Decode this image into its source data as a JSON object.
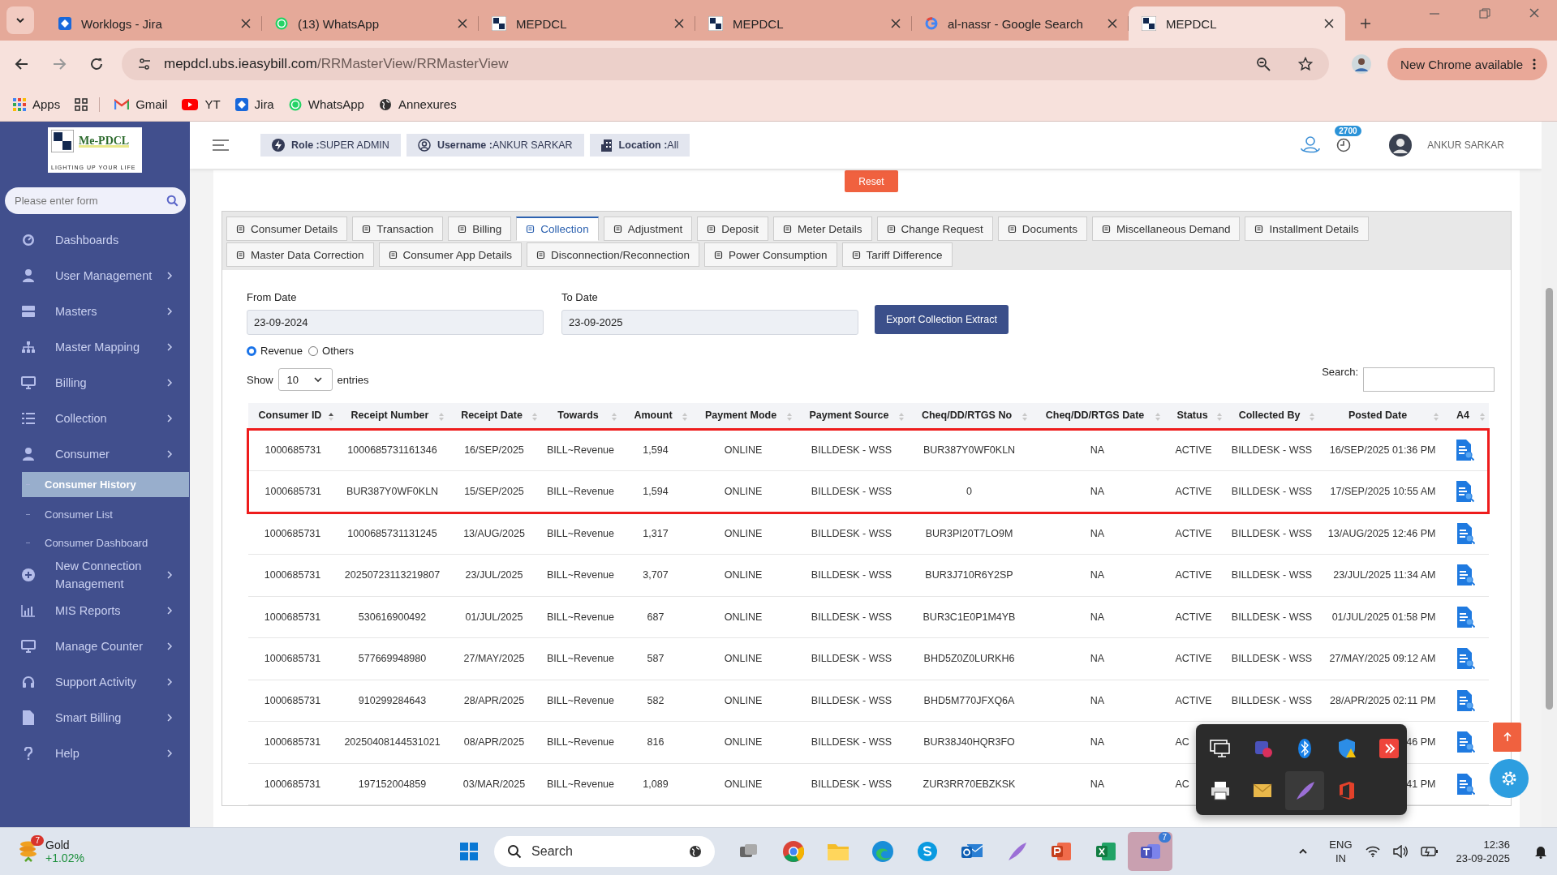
{
  "browser": {
    "tabs": [
      {
        "title": "Worklogs - Jira",
        "selected": false
      },
      {
        "title": "(13) WhatsApp",
        "selected": false
      },
      {
        "title": "MEPDCL",
        "selected": false
      },
      {
        "title": "MEPDCL",
        "selected": false
      },
      {
        "title": "al-nassr - Google Search",
        "selected": false
      },
      {
        "title": "MEPDCL",
        "selected": true
      }
    ],
    "url_host": "mepdcl.ubs.ieasybill.com",
    "url_path": "/RRMasterView/RRMasterView",
    "update_button": "New Chrome available",
    "bookmarks": [
      {
        "label": "Apps"
      },
      {
        "label": "Gmail"
      },
      {
        "label": "YT"
      },
      {
        "label": "Jira"
      },
      {
        "label": "WhatsApp"
      },
      {
        "label": "Annexures"
      }
    ]
  },
  "sidebar": {
    "logo": {
      "name": "Me-PDCL",
      "tagline": "LIGHTING UP YOUR LIFE"
    },
    "search": {
      "placeholder": "Please enter form"
    },
    "items": [
      {
        "label": "Dashboards",
        "arrow": false
      },
      {
        "label": "User Management",
        "arrow": true
      },
      {
        "label": "Masters",
        "arrow": true
      },
      {
        "label": "Master Mapping",
        "arrow": true
      },
      {
        "label": "Billing",
        "arrow": true
      },
      {
        "label": "Collection",
        "arrow": true
      },
      {
        "label": "Consumer",
        "arrow": true,
        "expanded": true,
        "children": [
          {
            "label": "Consumer History",
            "selected": true
          },
          {
            "label": "Consumer List",
            "selected": false
          },
          {
            "label": "Consumer Dashboard",
            "selected": false
          }
        ]
      },
      {
        "label": "New Connection Management",
        "arrow": true
      },
      {
        "label": "MIS Reports",
        "arrow": true
      },
      {
        "label": "Manage Counter",
        "arrow": true
      },
      {
        "label": "Support Activity",
        "arrow": true
      },
      {
        "label": "Smart Billing",
        "arrow": true
      },
      {
        "label": "Help",
        "arrow": true
      }
    ]
  },
  "header": {
    "chips": [
      {
        "label": "Role :",
        "value": "SUPER ADMIN"
      },
      {
        "label": "Username :",
        "value": "ANKUR SARKAR"
      },
      {
        "label": "Location :",
        "value": "All"
      }
    ],
    "badge": "2700",
    "user": "ANKUR SARKAR"
  },
  "reset_button": "Reset",
  "tabs": [
    [
      {
        "label": "Consumer Details",
        "selected": false
      },
      {
        "label": "Transaction",
        "selected": false
      },
      {
        "label": "Billing",
        "selected": false
      },
      {
        "label": "Collection",
        "selected": true
      },
      {
        "label": "Adjustment",
        "selected": false
      },
      {
        "label": "Deposit",
        "selected": false
      },
      {
        "label": "Meter Details",
        "selected": false
      },
      {
        "label": "Change Request",
        "selected": false
      },
      {
        "label": "Documents",
        "selected": false
      },
      {
        "label": "Miscellaneous Demand",
        "selected": false
      },
      {
        "label": "Installment Details",
        "selected": false
      }
    ],
    [
      {
        "label": "Master Data Correction",
        "selected": false
      },
      {
        "label": "Consumer App Details",
        "selected": false
      },
      {
        "label": "Disconnection/Reconnection",
        "selected": false
      },
      {
        "label": "Power Consumption",
        "selected": false
      },
      {
        "label": "Tariff Difference",
        "selected": false
      }
    ]
  ],
  "form": {
    "from_label": "From Date",
    "from_value": "23-09-2024",
    "to_label": "To Date",
    "to_value": "23-09-2025",
    "export_button": "Export Collection Extract",
    "radios": [
      {
        "label": "Revenue",
        "selected": true
      },
      {
        "label": "Others",
        "selected": false
      }
    ],
    "show_label": "Show",
    "page_size": "10",
    "entries_label": "entries",
    "search_label": "Search:"
  },
  "table": {
    "columns": [
      {
        "label": "Consumer ID",
        "sorted": true
      },
      {
        "label": "Receipt Number",
        "sorted": false
      },
      {
        "label": "Receipt Date",
        "sorted": false
      },
      {
        "label": "Towards",
        "sorted": false
      },
      {
        "label": "Amount",
        "sorted": false
      },
      {
        "label": "Payment Mode",
        "sorted": false
      },
      {
        "label": "Payment Source",
        "sorted": false
      },
      {
        "label": "Cheq/DD/RTGS No",
        "sorted": false
      },
      {
        "label": "Cheq/DD/RTGS Date",
        "sorted": false
      },
      {
        "label": "Status",
        "sorted": false
      },
      {
        "label": "Collected By",
        "sorted": false
      },
      {
        "label": "Posted Date",
        "sorted": false
      },
      {
        "label": "A4",
        "sorted": false
      }
    ],
    "rows": [
      {
        "highlighted": true,
        "consumer_id": "1000685731",
        "receipt_number": "1000685731161346",
        "receipt_date": "16/SEP/2025",
        "towards": "BILL~Revenue",
        "amount": "1,594",
        "payment_mode": "ONLINE",
        "payment_source": "BILLDESK - WSS",
        "cheq_no": "BUR387Y0WF0KLN",
        "cheq_date": "NA",
        "status": "ACTIVE",
        "collected_by": "BILLDESK - WSS",
        "posted_date": "16/SEP/2025 01:36 PM"
      },
      {
        "highlighted": true,
        "consumer_id": "1000685731",
        "receipt_number": "BUR387Y0WF0KLN",
        "receipt_date": "15/SEP/2025",
        "towards": "BILL~Revenue",
        "amount": "1,594",
        "payment_mode": "ONLINE",
        "payment_source": "BILLDESK - WSS",
        "cheq_no": "0",
        "cheq_date": "NA",
        "status": "ACTIVE",
        "collected_by": "BILLDESK - WSS",
        "posted_date": "17/SEP/2025 10:55 AM"
      },
      {
        "highlighted": false,
        "consumer_id": "1000685731",
        "receipt_number": "1000685731131245",
        "receipt_date": "13/AUG/2025",
        "towards": "BILL~Revenue",
        "amount": "1,317",
        "payment_mode": "ONLINE",
        "payment_source": "BILLDESK - WSS",
        "cheq_no": "BUR3PI20T7LO9M",
        "cheq_date": "NA",
        "status": "ACTIVE",
        "collected_by": "BILLDESK - WSS",
        "posted_date": "13/AUG/2025 12:46 PM"
      },
      {
        "highlighted": false,
        "consumer_id": "1000685731",
        "receipt_number": "20250723113219807",
        "receipt_date": "23/JUL/2025",
        "towards": "BILL~Revenue",
        "amount": "3,707",
        "payment_mode": "ONLINE",
        "payment_source": "BILLDESK - WSS",
        "cheq_no": "BUR3J710R6Y2SP",
        "cheq_date": "NA",
        "status": "ACTIVE",
        "collected_by": "BILLDESK - WSS",
        "posted_date": "23/JUL/2025 11:34 AM"
      },
      {
        "highlighted": false,
        "consumer_id": "1000685731",
        "receipt_number": "530616900492",
        "receipt_date": "01/JUL/2025",
        "towards": "BILL~Revenue",
        "amount": "687",
        "payment_mode": "ONLINE",
        "payment_source": "BILLDESK - WSS",
        "cheq_no": "BUR3C1E0P1M4YB",
        "cheq_date": "NA",
        "status": "ACTIVE",
        "collected_by": "BILLDESK - WSS",
        "posted_date": "01/JUL/2025 01:58 PM"
      },
      {
        "highlighted": false,
        "consumer_id": "1000685731",
        "receipt_number": "577669948980",
        "receipt_date": "27/MAY/2025",
        "towards": "BILL~Revenue",
        "amount": "587",
        "payment_mode": "ONLINE",
        "payment_source": "BILLDESK - WSS",
        "cheq_no": "BHD5Z0Z0LURKH6",
        "cheq_date": "NA",
        "status": "ACTIVE",
        "collected_by": "BILLDESK - WSS",
        "posted_date": "27/MAY/2025 09:12 AM"
      },
      {
        "highlighted": false,
        "consumer_id": "1000685731",
        "receipt_number": "910299284643",
        "receipt_date": "28/APR/2025",
        "towards": "BILL~Revenue",
        "amount": "582",
        "payment_mode": "ONLINE",
        "payment_source": "BILLDESK - WSS",
        "cheq_no": "BHD5M770JFXQ6A",
        "cheq_date": "NA",
        "status": "ACTIVE",
        "collected_by": "BILLDESK - WSS",
        "posted_date": "28/APR/2025 02:11 PM"
      },
      {
        "highlighted": false,
        "consumer_id": "1000685731",
        "receipt_number": "20250408144531021",
        "receipt_date": "08/APR/2025",
        "towards": "BILL~Revenue",
        "amount": "816",
        "payment_mode": "ONLINE",
        "payment_source": "BILLDESK - WSS",
        "cheq_no": "BUR38J40HQR3FO",
        "cheq_date": "NA",
        "status": "AC",
        "posted_date": "46 PM"
      },
      {
        "highlighted": false,
        "consumer_id": "1000685731",
        "receipt_number": "197152004859",
        "receipt_date": "03/MAR/2025",
        "towards": "BILL~Revenue",
        "amount": "1,089",
        "payment_mode": "ONLINE",
        "payment_source": "BILLDESK - WSS",
        "cheq_no": "ZUR3RR70EBZKSK",
        "cheq_date": "NA",
        "status": "AC",
        "posted_date": "41 PM"
      }
    ]
  },
  "taskbar": {
    "widget": {
      "badge": "7",
      "title": "Gold",
      "change": "+1.02%"
    },
    "search_placeholder": "Search",
    "teams_badge": "7",
    "language": "ENG",
    "region": "IN",
    "time": "12:36",
    "date": "23-09-2025"
  }
}
